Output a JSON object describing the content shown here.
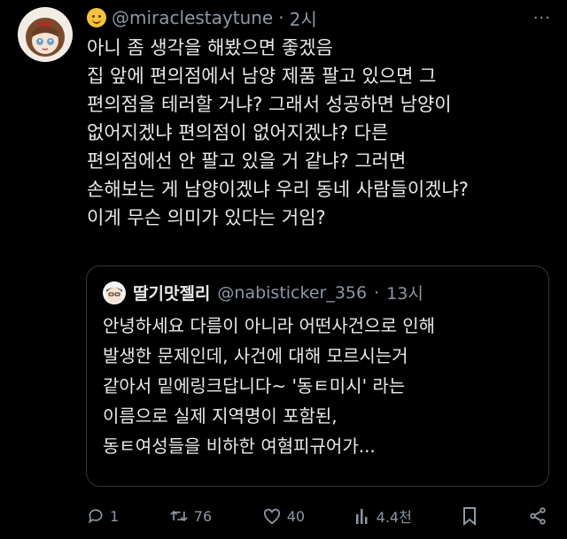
{
  "tweet": {
    "handle": "@miraclestaytune",
    "dot": "·",
    "time": "2시",
    "more": "···",
    "text": "아니 좀 생각을 해봤으면 좋겠음\n집 앞에 편의점에서 남양 제품 팔고 있으면 그\n편의점을 테러할 거냐? 그래서 성공하면 남양이\n없어지겠냐 편의점이 없어지겠냐? 다른\n편의점에선 안 팔고 있을 거 같냐? 그러면\n손해보는 게 남양이겠냐 우리 동네 사람들이겠냐?\n이게 무슨 의미가 있다는 거임?"
  },
  "quote": {
    "name": "딸기맛젤리",
    "handle": "@nabisticker_356",
    "dot": "·",
    "time": "13시",
    "text": "안녕하세요 다름이 아니라 어떤사건으로 인해\n발생한 문제인데, 사건에 대해 모르시는거\n같아서 밑에링크답니다~ '동ㅌ미시' 라는\n이름으로 실제 지역명이 포함된,\n동ㅌ여성들을 비하한 여혐피규어가..."
  },
  "actions": {
    "reply_count": "1",
    "retweet_count": "76",
    "like_count": "40",
    "view_count": "4.4천"
  },
  "colors": {
    "background": "#000000",
    "text": "#e7e9ea",
    "muted": "#8b98a5",
    "border": "#333639"
  },
  "icons": [
    "avatar",
    "smiley-emoji-icon",
    "more-icon",
    "quote-avatar",
    "reply-icon",
    "retweet-icon",
    "like-icon",
    "views-icon",
    "bookmark-icon",
    "share-icon"
  ]
}
